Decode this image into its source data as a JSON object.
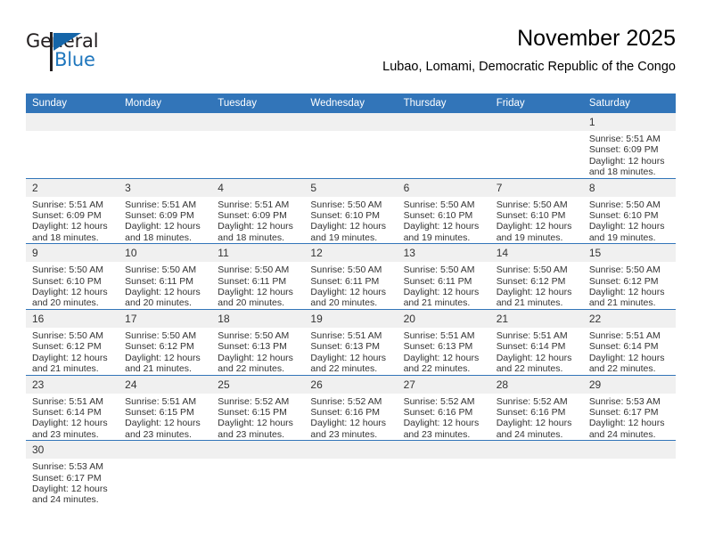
{
  "brand": {
    "name_top": "General",
    "name_bottom": "Blue",
    "accent_color": "#1e76bd",
    "triangle_color": "#1565a8"
  },
  "header": {
    "title": "November 2025",
    "subtitle": "Lubao, Lomami, Democratic Republic of the Congo"
  },
  "colors": {
    "header_row_bg": "#3275b9",
    "daynum_bg": "#f0f0f0",
    "row_divider": "#3275b9",
    "text": "#333333"
  },
  "weekday_headers": [
    "Sunday",
    "Monday",
    "Tuesday",
    "Wednesday",
    "Thursday",
    "Friday",
    "Saturday"
  ],
  "weeks": [
    [
      {
        "day": "",
        "blank": true
      },
      {
        "day": "",
        "blank": true
      },
      {
        "day": "",
        "blank": true
      },
      {
        "day": "",
        "blank": true
      },
      {
        "day": "",
        "blank": true
      },
      {
        "day": "",
        "blank": true
      },
      {
        "day": "1",
        "sunrise": "Sunrise: 5:51 AM",
        "sunset": "Sunset: 6:09 PM",
        "daylight1": "Daylight: 12 hours",
        "daylight2": "and 18 minutes."
      }
    ],
    [
      {
        "day": "2",
        "sunrise": "Sunrise: 5:51 AM",
        "sunset": "Sunset: 6:09 PM",
        "daylight1": "Daylight: 12 hours",
        "daylight2": "and 18 minutes."
      },
      {
        "day": "3",
        "sunrise": "Sunrise: 5:51 AM",
        "sunset": "Sunset: 6:09 PM",
        "daylight1": "Daylight: 12 hours",
        "daylight2": "and 18 minutes."
      },
      {
        "day": "4",
        "sunrise": "Sunrise: 5:51 AM",
        "sunset": "Sunset: 6:09 PM",
        "daylight1": "Daylight: 12 hours",
        "daylight2": "and 18 minutes."
      },
      {
        "day": "5",
        "sunrise": "Sunrise: 5:50 AM",
        "sunset": "Sunset: 6:10 PM",
        "daylight1": "Daylight: 12 hours",
        "daylight2": "and 19 minutes."
      },
      {
        "day": "6",
        "sunrise": "Sunrise: 5:50 AM",
        "sunset": "Sunset: 6:10 PM",
        "daylight1": "Daylight: 12 hours",
        "daylight2": "and 19 minutes."
      },
      {
        "day": "7",
        "sunrise": "Sunrise: 5:50 AM",
        "sunset": "Sunset: 6:10 PM",
        "daylight1": "Daylight: 12 hours",
        "daylight2": "and 19 minutes."
      },
      {
        "day": "8",
        "sunrise": "Sunrise: 5:50 AM",
        "sunset": "Sunset: 6:10 PM",
        "daylight1": "Daylight: 12 hours",
        "daylight2": "and 19 minutes."
      }
    ],
    [
      {
        "day": "9",
        "sunrise": "Sunrise: 5:50 AM",
        "sunset": "Sunset: 6:10 PM",
        "daylight1": "Daylight: 12 hours",
        "daylight2": "and 20 minutes."
      },
      {
        "day": "10",
        "sunrise": "Sunrise: 5:50 AM",
        "sunset": "Sunset: 6:11 PM",
        "daylight1": "Daylight: 12 hours",
        "daylight2": "and 20 minutes."
      },
      {
        "day": "11",
        "sunrise": "Sunrise: 5:50 AM",
        "sunset": "Sunset: 6:11 PM",
        "daylight1": "Daylight: 12 hours",
        "daylight2": "and 20 minutes."
      },
      {
        "day": "12",
        "sunrise": "Sunrise: 5:50 AM",
        "sunset": "Sunset: 6:11 PM",
        "daylight1": "Daylight: 12 hours",
        "daylight2": "and 20 minutes."
      },
      {
        "day": "13",
        "sunrise": "Sunrise: 5:50 AM",
        "sunset": "Sunset: 6:11 PM",
        "daylight1": "Daylight: 12 hours",
        "daylight2": "and 21 minutes."
      },
      {
        "day": "14",
        "sunrise": "Sunrise: 5:50 AM",
        "sunset": "Sunset: 6:12 PM",
        "daylight1": "Daylight: 12 hours",
        "daylight2": "and 21 minutes."
      },
      {
        "day": "15",
        "sunrise": "Sunrise: 5:50 AM",
        "sunset": "Sunset: 6:12 PM",
        "daylight1": "Daylight: 12 hours",
        "daylight2": "and 21 minutes."
      }
    ],
    [
      {
        "day": "16",
        "sunrise": "Sunrise: 5:50 AM",
        "sunset": "Sunset: 6:12 PM",
        "daylight1": "Daylight: 12 hours",
        "daylight2": "and 21 minutes."
      },
      {
        "day": "17",
        "sunrise": "Sunrise: 5:50 AM",
        "sunset": "Sunset: 6:12 PM",
        "daylight1": "Daylight: 12 hours",
        "daylight2": "and 21 minutes."
      },
      {
        "day": "18",
        "sunrise": "Sunrise: 5:50 AM",
        "sunset": "Sunset: 6:13 PM",
        "daylight1": "Daylight: 12 hours",
        "daylight2": "and 22 minutes."
      },
      {
        "day": "19",
        "sunrise": "Sunrise: 5:51 AM",
        "sunset": "Sunset: 6:13 PM",
        "daylight1": "Daylight: 12 hours",
        "daylight2": "and 22 minutes."
      },
      {
        "day": "20",
        "sunrise": "Sunrise: 5:51 AM",
        "sunset": "Sunset: 6:13 PM",
        "daylight1": "Daylight: 12 hours",
        "daylight2": "and 22 minutes."
      },
      {
        "day": "21",
        "sunrise": "Sunrise: 5:51 AM",
        "sunset": "Sunset: 6:14 PM",
        "daylight1": "Daylight: 12 hours",
        "daylight2": "and 22 minutes."
      },
      {
        "day": "22",
        "sunrise": "Sunrise: 5:51 AM",
        "sunset": "Sunset: 6:14 PM",
        "daylight1": "Daylight: 12 hours",
        "daylight2": "and 22 minutes."
      }
    ],
    [
      {
        "day": "23",
        "sunrise": "Sunrise: 5:51 AM",
        "sunset": "Sunset: 6:14 PM",
        "daylight1": "Daylight: 12 hours",
        "daylight2": "and 23 minutes."
      },
      {
        "day": "24",
        "sunrise": "Sunrise: 5:51 AM",
        "sunset": "Sunset: 6:15 PM",
        "daylight1": "Daylight: 12 hours",
        "daylight2": "and 23 minutes."
      },
      {
        "day": "25",
        "sunrise": "Sunrise: 5:52 AM",
        "sunset": "Sunset: 6:15 PM",
        "daylight1": "Daylight: 12 hours",
        "daylight2": "and 23 minutes."
      },
      {
        "day": "26",
        "sunrise": "Sunrise: 5:52 AM",
        "sunset": "Sunset: 6:16 PM",
        "daylight1": "Daylight: 12 hours",
        "daylight2": "and 23 minutes."
      },
      {
        "day": "27",
        "sunrise": "Sunrise: 5:52 AM",
        "sunset": "Sunset: 6:16 PM",
        "daylight1": "Daylight: 12 hours",
        "daylight2": "and 23 minutes."
      },
      {
        "day": "28",
        "sunrise": "Sunrise: 5:52 AM",
        "sunset": "Sunset: 6:16 PM",
        "daylight1": "Daylight: 12 hours",
        "daylight2": "and 24 minutes."
      },
      {
        "day": "29",
        "sunrise": "Sunrise: 5:53 AM",
        "sunset": "Sunset: 6:17 PM",
        "daylight1": "Daylight: 12 hours",
        "daylight2": "and 24 minutes."
      }
    ],
    [
      {
        "day": "30",
        "sunrise": "Sunrise: 5:53 AM",
        "sunset": "Sunset: 6:17 PM",
        "daylight1": "Daylight: 12 hours",
        "daylight2": "and 24 minutes."
      },
      {
        "day": "",
        "blank": true
      },
      {
        "day": "",
        "blank": true
      },
      {
        "day": "",
        "blank": true
      },
      {
        "day": "",
        "blank": true
      },
      {
        "day": "",
        "blank": true
      },
      {
        "day": "",
        "blank": true
      }
    ]
  ]
}
